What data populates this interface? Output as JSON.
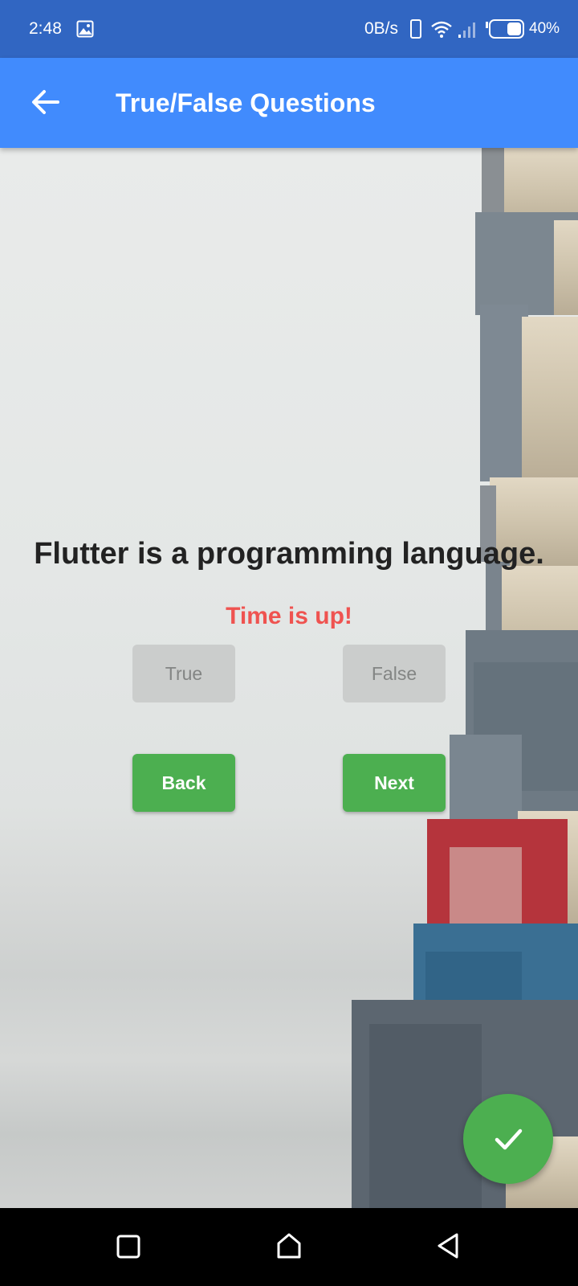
{
  "status_bar": {
    "time": "2:48",
    "net_speed": "0B/s",
    "battery": "40%",
    "icons": [
      "image-icon",
      "phone-icon",
      "wifi-icon",
      "signal-icon",
      "battery-icon"
    ]
  },
  "app_bar": {
    "title": "True/False Questions",
    "back_icon": "arrow-left-icon"
  },
  "question": {
    "text": "Flutter is a programming language.",
    "status": "Time is up!"
  },
  "answers": {
    "true_label": "True",
    "false_label": "False"
  },
  "navigation": {
    "back_label": "Back",
    "next_label": "Next"
  },
  "fab": {
    "icon": "check-icon"
  },
  "system_nav": {
    "icons": [
      "recents-icon",
      "home-icon",
      "back-triangle-icon"
    ]
  },
  "colors": {
    "status_bar": "#3166c2",
    "app_bar": "#418bfd",
    "accent_green": "#4caf50",
    "time_up_red": "#ef5350",
    "disabled_button": "#cbcdcc"
  }
}
